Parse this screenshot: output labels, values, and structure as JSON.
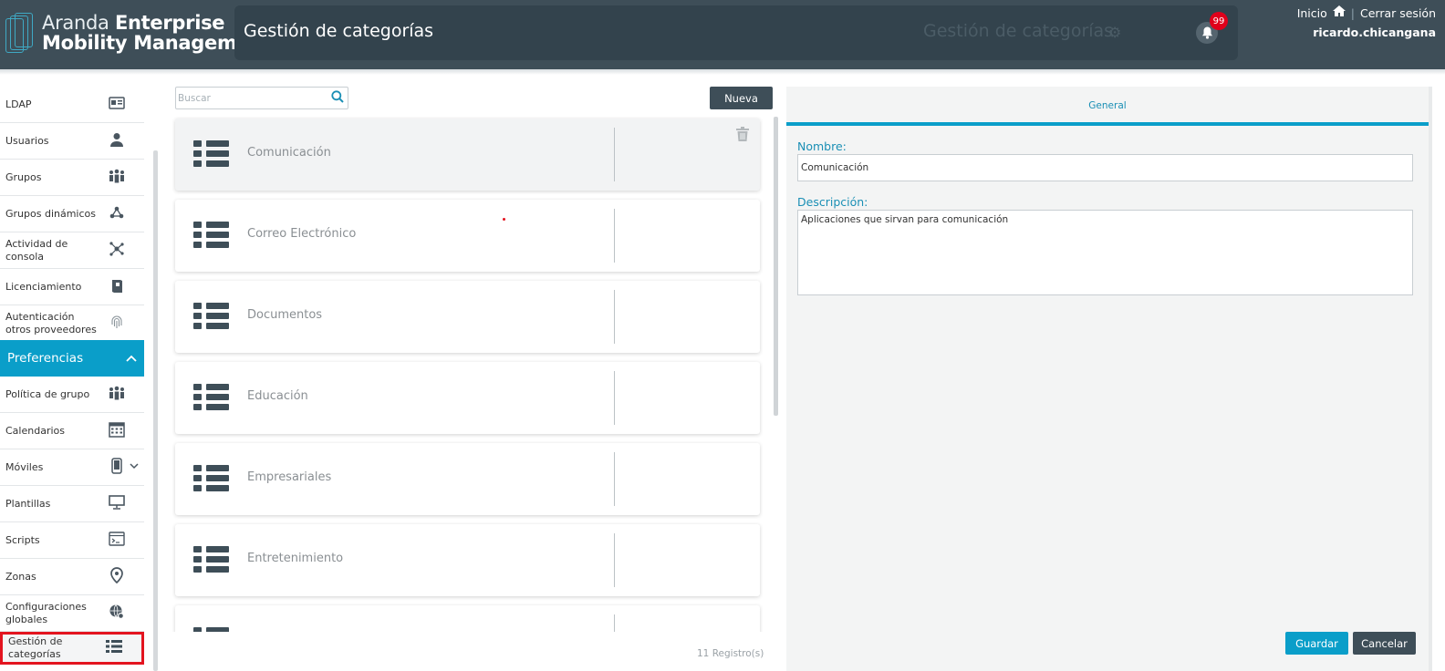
{
  "header": {
    "brand_light": "Aranda",
    "brand_bold_1": "Enterprise",
    "brand_bold_2": "Mobility Management",
    "page_title": "Gestión de categorías",
    "ghost_title": "Gestión de categorías",
    "notification_count": "99",
    "link_home": "Inicio",
    "link_separator": "|",
    "link_logout": "Cerrar sesión",
    "username": "ricardo.chicangana",
    "icons": {
      "home": "home-icon",
      "bell": "bell-icon",
      "gear": "gear-icon"
    }
  },
  "sidebar": {
    "items": [
      {
        "label": "LDAP",
        "icon": "id-card-icon"
      },
      {
        "label": "Usuarios",
        "icon": "user-icon"
      },
      {
        "label": "Grupos",
        "icon": "group-icon"
      },
      {
        "label": "Grupos dinámicos",
        "icon": "network-icon"
      },
      {
        "label": "Actividad de consola",
        "icon": "hub-icon"
      },
      {
        "label": "Licenciamiento",
        "icon": "license-book-icon"
      },
      {
        "label": "Autenticación otros proveedores",
        "icon": "fingerprint-icon"
      }
    ],
    "section": {
      "label": "Preferencias",
      "icon": "chevron-up-icon"
    },
    "section_items": [
      {
        "label": "Política de grupo",
        "icon": "group-icon"
      },
      {
        "label": "Calendarios",
        "icon": "calendar-icon"
      },
      {
        "label": "Móviles",
        "icon": "mobile-icon",
        "expandable": true
      },
      {
        "label": "Plantillas",
        "icon": "presentation-icon"
      },
      {
        "label": "Scripts",
        "icon": "terminal-icon"
      },
      {
        "label": "Zonas",
        "icon": "map-pin-icon"
      },
      {
        "label": "Configuraciones globales",
        "icon": "globe-gear-icon"
      },
      {
        "label": "Gestión de categorías",
        "icon": "list-icon",
        "active": true
      }
    ]
  },
  "list": {
    "search_placeholder": "Buscar",
    "new_button": "Nueva",
    "categories": [
      "Comunicación",
      "Correo Electrónico",
      "Documentos",
      "Educación",
      "Empresariales",
      "Entretenimiento",
      ""
    ],
    "selected_index": 0,
    "records_label": "11 Registro(s)"
  },
  "detail": {
    "tab_label": "General",
    "name_label": "Nombre:",
    "name_value": "Comunicación",
    "description_label": "Descripción:",
    "description_value": "Aplicaciones que sirvan para comunicación",
    "save_button": "Guardar",
    "cancel_button": "Cancelar"
  },
  "colors": {
    "header_bg": "#3e4e58",
    "accent": "#0a9ec9",
    "active_border": "#e3141f",
    "badge": "#e0001b"
  }
}
